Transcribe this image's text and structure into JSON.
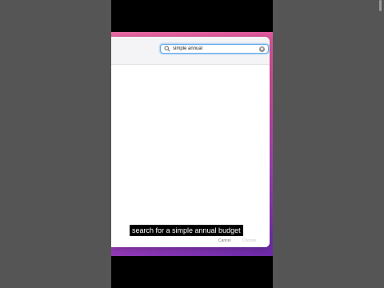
{
  "search": {
    "value": "simple annual"
  },
  "dialog": {
    "cancel_label": "Cancel",
    "choose_label": "Choose"
  },
  "caption": {
    "text": "search for a simple annual budget"
  },
  "colors": {
    "focus_ring": "#5fa9ea",
    "wallpaper_top": "#e86aa3",
    "wallpaper_bottom": "#6a2aa8"
  }
}
